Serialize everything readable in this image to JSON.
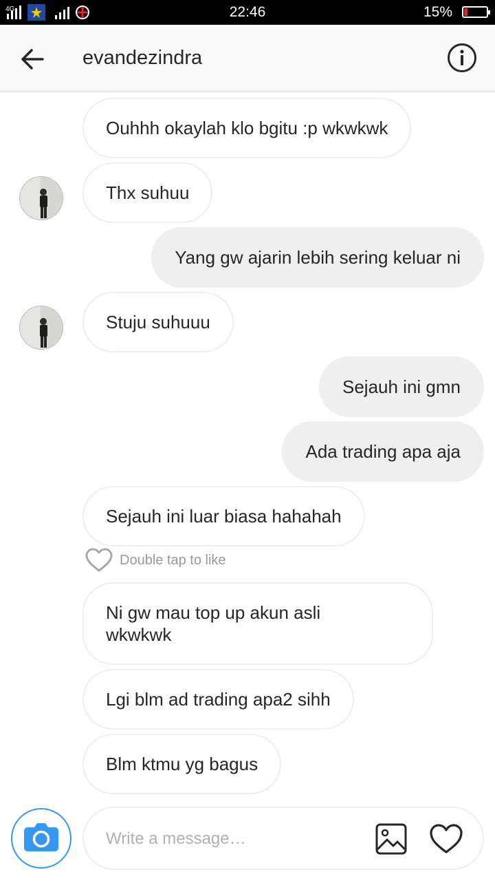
{
  "status_bar": {
    "network": "4G",
    "time": "22:46",
    "battery_percent": "15%",
    "battery_level": 0.15,
    "battery_color": "#e5202a"
  },
  "header": {
    "back_icon": "arrow-left-icon",
    "username": "evandezindra",
    "info_icon": "info-icon"
  },
  "messages": [
    {
      "dir": "in",
      "text": "Ouhhh okaylah klo bgitu :p wkwkwk",
      "avatar": false
    },
    {
      "dir": "in",
      "text": "Thx suhuu",
      "avatar": true
    },
    {
      "dir": "out",
      "text": "Yang gw ajarin lebih sering keluar ni"
    },
    {
      "dir": "in",
      "text": "Stuju suhuuu",
      "avatar": true
    },
    {
      "dir": "out",
      "text": "Sejauh ini gmn"
    },
    {
      "dir": "out",
      "text": "Ada trading apa aja"
    },
    {
      "dir": "in",
      "text": "Sejauh ini luar biasa hahahah",
      "avatar": false
    },
    {
      "dir": "in",
      "text": "Ni gw mau top up akun asli\nwkwkwk",
      "avatar": false
    },
    {
      "dir": "in",
      "text": "Lgi blm ad trading apa2 sihh",
      "avatar": false
    },
    {
      "dir": "in",
      "text": "Blm ktmu yg bagus",
      "avatar": false
    }
  ],
  "like_hint": "Double tap to like",
  "composer": {
    "placeholder": "Write a message…",
    "camera_icon": "camera-icon",
    "gallery_icon": "gallery-icon",
    "heart_icon": "heart-icon",
    "accent": "#3897f0"
  }
}
